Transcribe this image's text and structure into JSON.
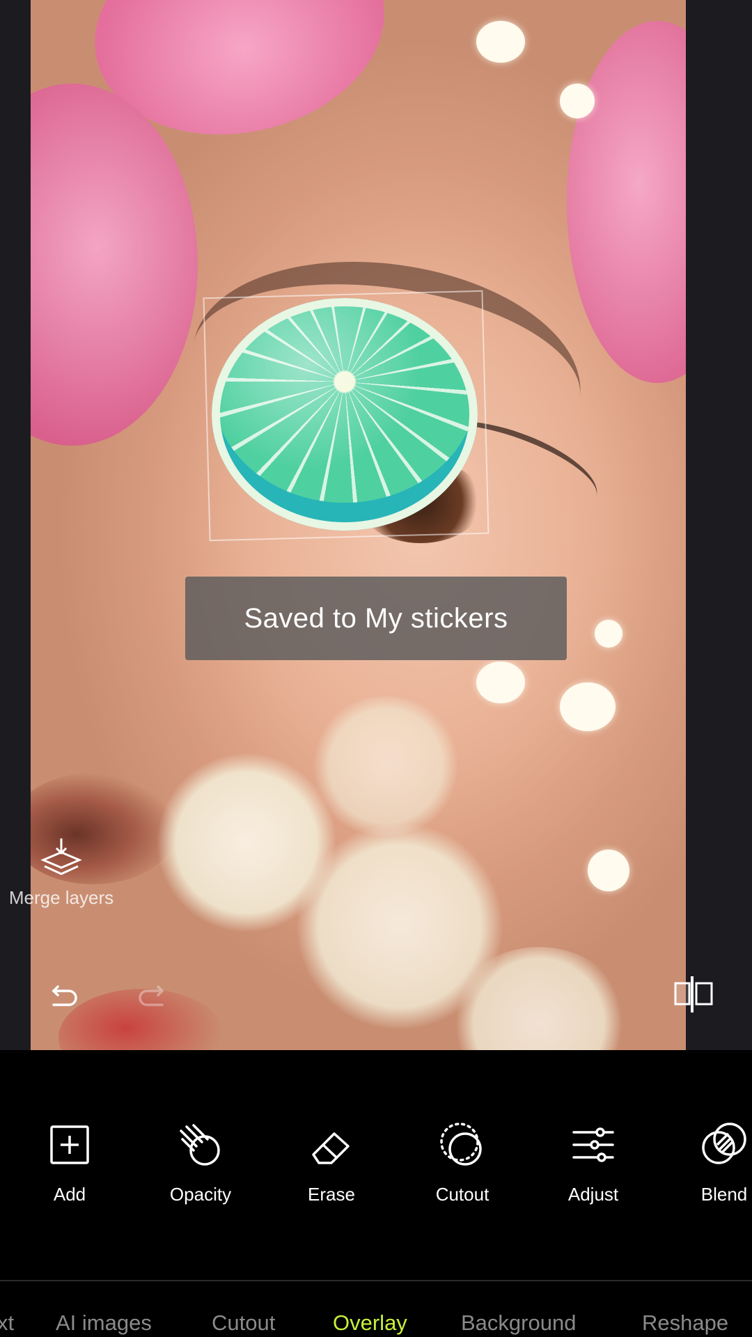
{
  "toast": {
    "message": "Saved to My stickers"
  },
  "canvas": {
    "merge_layers_label": "Merge layers"
  },
  "tools": [
    {
      "label": "Add",
      "icon": "plus-square-icon"
    },
    {
      "label": "Opacity",
      "icon": "opacity-hand-icon"
    },
    {
      "label": "Erase",
      "icon": "eraser-icon"
    },
    {
      "label": "Cutout",
      "icon": "cutout-icon"
    },
    {
      "label": "Adjust",
      "icon": "sliders-icon"
    },
    {
      "label": "Blend",
      "icon": "blend-icon"
    }
  ],
  "tabs": [
    {
      "label": "xt"
    },
    {
      "label": "AI images"
    },
    {
      "label": "Cutout"
    },
    {
      "label": "Overlay",
      "active": true
    },
    {
      "label": "Background"
    },
    {
      "label": "Reshape"
    }
  ],
  "colors": {
    "accent": "#c8f13a",
    "toolbar_bg": "#000000",
    "toast_bg": "#5a5a5c"
  }
}
